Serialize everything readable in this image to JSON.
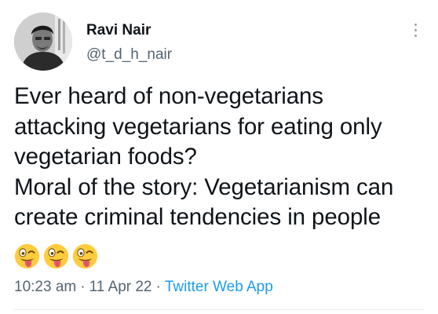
{
  "author": {
    "display_name": "Ravi Nair",
    "handle": "@t_d_h_nair"
  },
  "tweet": {
    "lines": [
      "Ever heard of non-vegetarians",
      "attacking vegetarians for eating only",
      "vegetarian foods?",
      "Moral of the story: Vegetarianism can",
      "create criminal tendencies in people"
    ],
    "emojis": [
      "winking-face-with-tongue",
      "winking-face-with-tongue",
      "winking-face-with-tongue"
    ]
  },
  "meta": {
    "time": "10:23 am",
    "date": "11 Apr 22",
    "separator": "·",
    "source": "Twitter Web App"
  },
  "colors": {
    "text": "#0f1419",
    "secondary": "#536471",
    "link": "#1d9bf0",
    "emoji_face": "#ffcc3e"
  }
}
